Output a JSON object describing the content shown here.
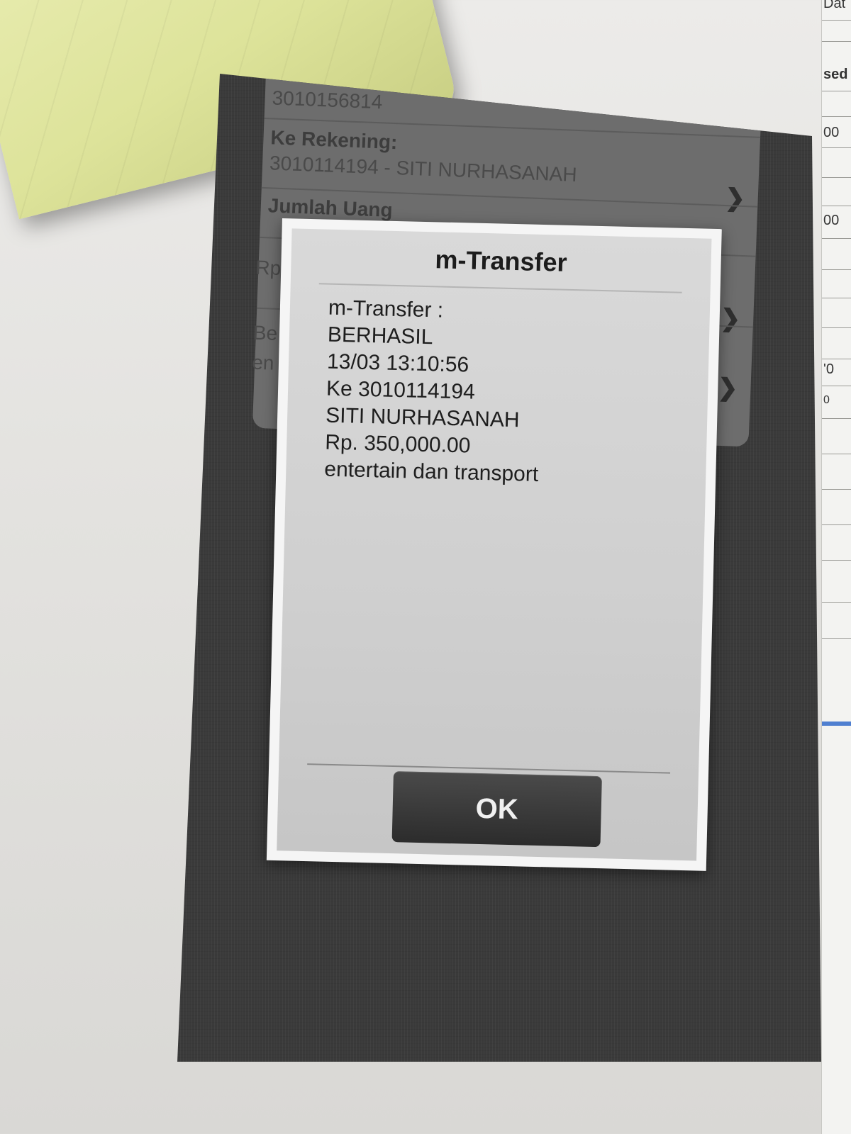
{
  "background_form": {
    "from_account": "3010156814",
    "to_account_label": "Ke Rekening:",
    "to_account_value": "3010114194 - SITI NURHASANAH",
    "amount_label": "Jumlah Uang",
    "amount_prefix": "Rp",
    "field_partial_1": "Be",
    "field_partial_2": "en"
  },
  "dialog": {
    "title": "m-Transfer",
    "message_lines": [
      "m-Transfer :",
      "BERHASIL",
      "13/03 13:10:56",
      "Ke 3010114194",
      "SITI NURHASANAH",
      "Rp. 350,000.00",
      "entertain dan transport"
    ],
    "ok_label": "OK"
  },
  "side_paper": {
    "texts": [
      "Dat",
      "sed",
      "00",
      "00",
      "'0",
      "0"
    ]
  },
  "icons": {
    "chevron": "chevron-right-icon"
  }
}
